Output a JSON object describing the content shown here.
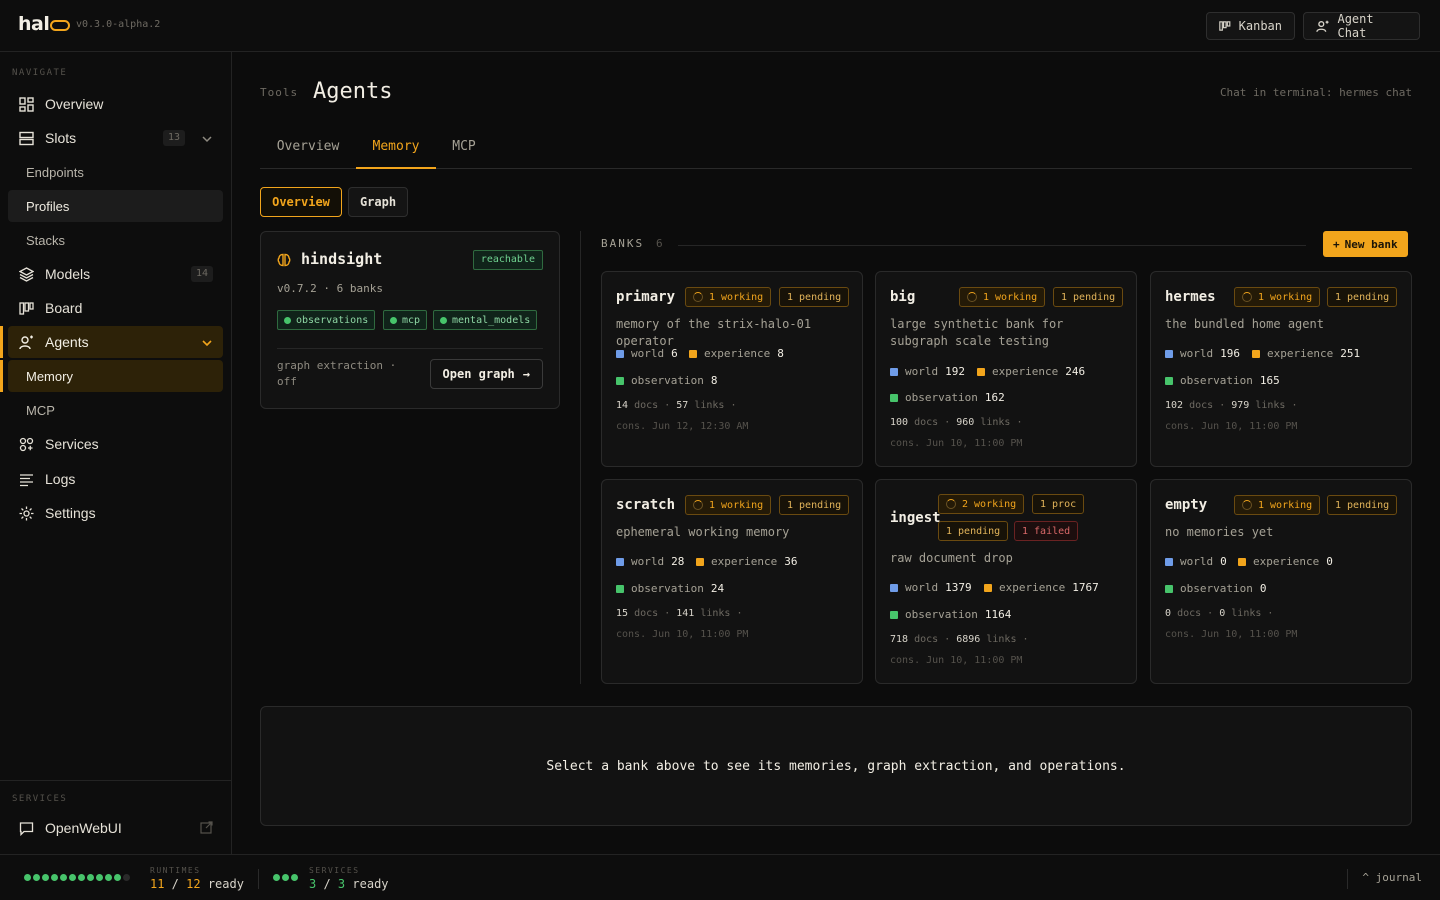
{
  "app": {
    "logo": "hal",
    "version": "v0.3.0-alpha.2"
  },
  "topbar": {
    "kanban": "Kanban",
    "agent_chat": "Agent Chat"
  },
  "sidebar": {
    "navigate_label": "NAVIGATE",
    "items": {
      "overview": "Overview",
      "slots": "Slots",
      "slots_count": "13",
      "endpoints": "Endpoints",
      "profiles": "Profiles",
      "stacks": "Stacks",
      "models": "Models",
      "models_count": "14",
      "board": "Board",
      "agents": "Agents",
      "memory": "Memory",
      "mcp": "MCP",
      "services": "Services",
      "logs": "Logs",
      "settings": "Settings"
    },
    "services_label": "SERVICES",
    "openwebui": "OpenWebUI"
  },
  "page": {
    "crumb": "Tools",
    "title": "Agents",
    "terminal_hint": "Chat in terminal: hermes chat",
    "tabs": [
      "Overview",
      "Memory",
      "MCP"
    ],
    "active_tab": "Memory",
    "segments": [
      "Overview",
      "Graph"
    ]
  },
  "hindsight": {
    "name": "hindsight",
    "status": "reachable",
    "meta": "v0.7.2 · 6 banks",
    "chips": [
      "observations",
      "mcp",
      "mental_models"
    ],
    "graph_extraction": "graph extraction · off",
    "open_graph": "Open graph"
  },
  "banks": {
    "label": "BANKS",
    "count": "6",
    "new_bank": "New bank",
    "items": [
      {
        "name": "primary",
        "working": "1 working",
        "pending": "1 pending",
        "desc": "memory of the strix-halo-01 operator",
        "world": "6",
        "experience": "8",
        "observation": "8",
        "docs": "14",
        "links": "57",
        "cons": "cons. Jun 12, 12:30 AM"
      },
      {
        "name": "big",
        "working": "1 working",
        "pending": "1 pending",
        "desc": "large synthetic bank for subgraph scale testing",
        "world": "192",
        "experience": "246",
        "observation": "162",
        "docs": "100",
        "links": "960",
        "cons": "cons. Jun 10, 11:00 PM"
      },
      {
        "name": "hermes",
        "working": "1 working",
        "pending": "1 pending",
        "desc": "the bundled home agent",
        "world": "196",
        "experience": "251",
        "observation": "165",
        "docs": "102",
        "links": "979",
        "cons": "cons. Jun 10, 11:00 PM"
      },
      {
        "name": "scratch",
        "working": "1 working",
        "pending": "1 pending",
        "desc": "ephemeral working memory",
        "world": "28",
        "experience": "36",
        "observation": "24",
        "docs": "15",
        "links": "141",
        "cons": "cons. Jun 10, 11:00 PM"
      },
      {
        "name": "ingest",
        "working": "2 working",
        "proc": "1 proc",
        "pending": "1 pending",
        "failed": "1 failed",
        "desc": "raw document drop",
        "world": "1379",
        "experience": "1767",
        "observation": "1164",
        "docs": "718",
        "links": "6896",
        "cons": "cons. Jun 10, 11:00 PM"
      },
      {
        "name": "empty",
        "working": "1 working",
        "pending": "1 pending",
        "desc": "no memories yet",
        "world": "0",
        "experience": "0",
        "observation": "0",
        "docs": "0",
        "links": "0",
        "cons": "cons. Jun 10, 11:00 PM"
      }
    ],
    "labels": {
      "world": "world",
      "experience": "experience",
      "observation": "observation",
      "docs": "docs",
      "links": "links"
    }
  },
  "detail": {
    "hint": "Select a bank above to see its memories, graph extraction, and operations."
  },
  "footer": {
    "runtimes_label": "RUNTIMES",
    "runtimes_ready": "11",
    "runtimes_total": "12",
    "services_label": "SERVICES",
    "services_ready": "3",
    "services_total": "3",
    "ready_word": "ready",
    "journal": "^ journal"
  },
  "colors": {
    "accent": "#f2a51c",
    "ok": "#47c46b",
    "world": "#6f9ce8",
    "fail": "#d86868"
  }
}
